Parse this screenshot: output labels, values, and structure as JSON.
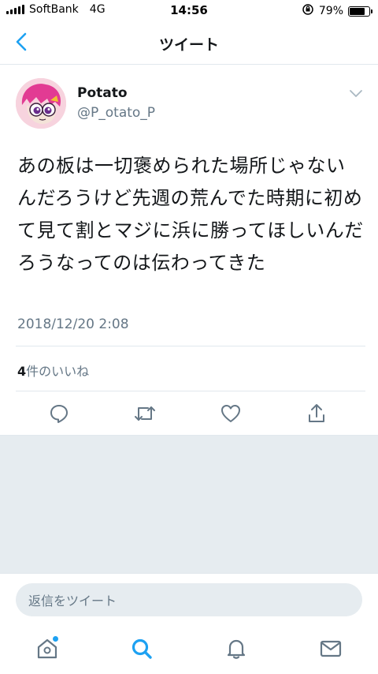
{
  "status_bar": {
    "carrier": "SoftBank",
    "network": "4G",
    "time": "14:56",
    "battery_percent": "79%",
    "battery_level": 0.79
  },
  "nav": {
    "title": "ツイート"
  },
  "tweet": {
    "display_name": "Potato",
    "handle": "@P_otato_P",
    "text": "あの板は一切褒められた場所じゃないんだろうけど先週の荒んでた時期に初めて見て割とマジに浜に勝ってほしいんだろうなってのは伝わってきた",
    "timestamp": "2018/12/20 2:08",
    "likes_count": "4",
    "likes_label": "件のいいね"
  },
  "reply": {
    "placeholder": "返信をツイート"
  },
  "colors": {
    "accent": "#1da1f2",
    "secondary_text": "#657786",
    "icon_gray": "#657786",
    "background_gray": "#e6ecf0"
  },
  "icons": {
    "actions": [
      "reply-icon",
      "retweet-icon",
      "like-icon",
      "share-icon"
    ],
    "tabs": [
      "home-icon",
      "search-icon",
      "notifications-icon",
      "messages-icon"
    ]
  }
}
